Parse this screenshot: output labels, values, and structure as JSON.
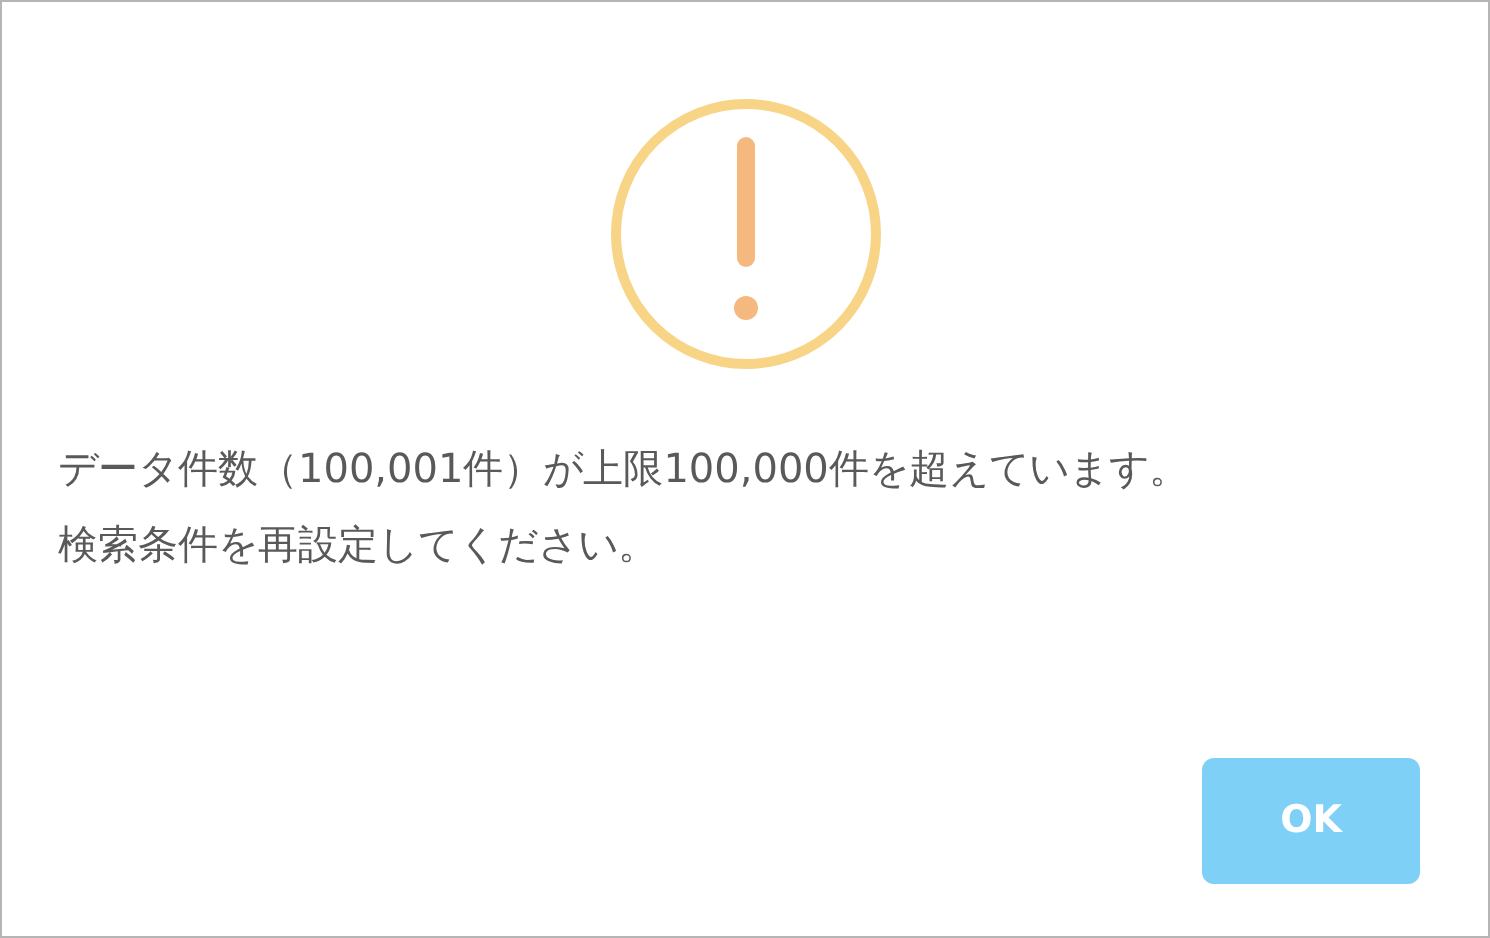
{
  "dialog": {
    "messages": [
      "データ件数（100,001件）が上限100,000件を超えています。",
      "検索条件を再設定してください。"
    ],
    "buttons": [
      {
        "label": "OK",
        "kind": "primary"
      }
    ]
  }
}
